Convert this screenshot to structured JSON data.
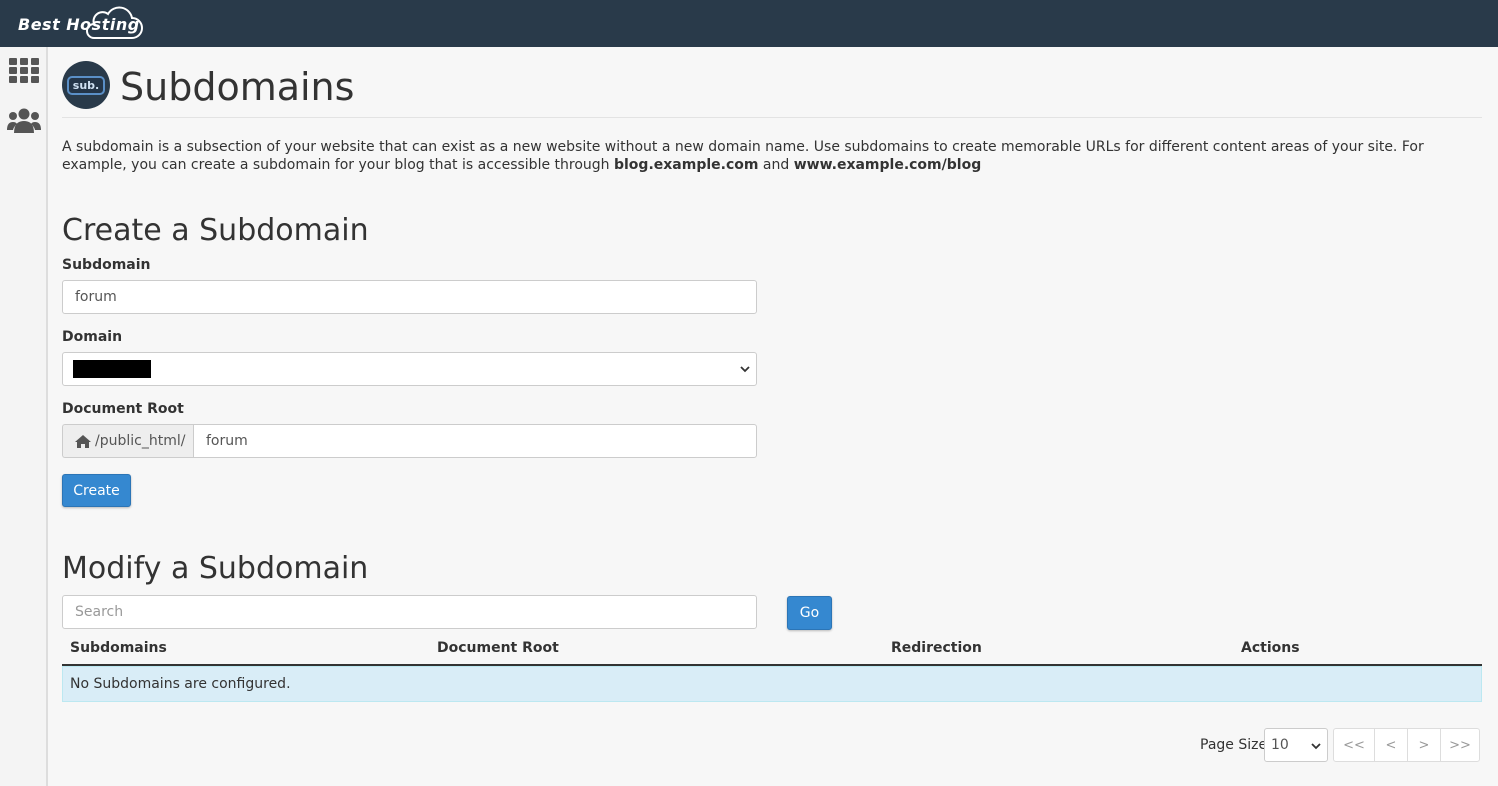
{
  "header": {
    "logo_text": "Best Hosting"
  },
  "sidebar": {
    "items": [
      {
        "icon": "grid-icon"
      },
      {
        "icon": "users-icon"
      }
    ]
  },
  "page": {
    "icon_text": "sub.",
    "title": "Subdomains"
  },
  "intro": {
    "text_before": "A subdomain is a subsection of your website that can exist as a new website without a new domain name. Use subdomains to create memorable URLs for different content areas of your site. For example, you can create a subdomain for your blog that is accessible through ",
    "example1": "blog.example.com",
    "and": " and ",
    "example2": "www.example.com/blog"
  },
  "create": {
    "heading": "Create a Subdomain",
    "subdomain_label": "Subdomain",
    "subdomain_value": "forum",
    "domain_label": "Domain",
    "document_root_label": "Document Root",
    "document_root_prefix": "/public_html/",
    "document_root_value": "forum",
    "create_button": "Create"
  },
  "modify": {
    "heading": "Modify a Subdomain",
    "search_placeholder": "Search",
    "go_button": "Go",
    "columns": [
      "Subdomains",
      "Document Root",
      "Redirection",
      "Actions"
    ],
    "empty_message": "No Subdomains are configured."
  },
  "pager": {
    "page_size_label": "Page Size",
    "page_size_value": "10",
    "first": "<<",
    "prev": "<",
    "next": ">",
    "last": ">>"
  }
}
